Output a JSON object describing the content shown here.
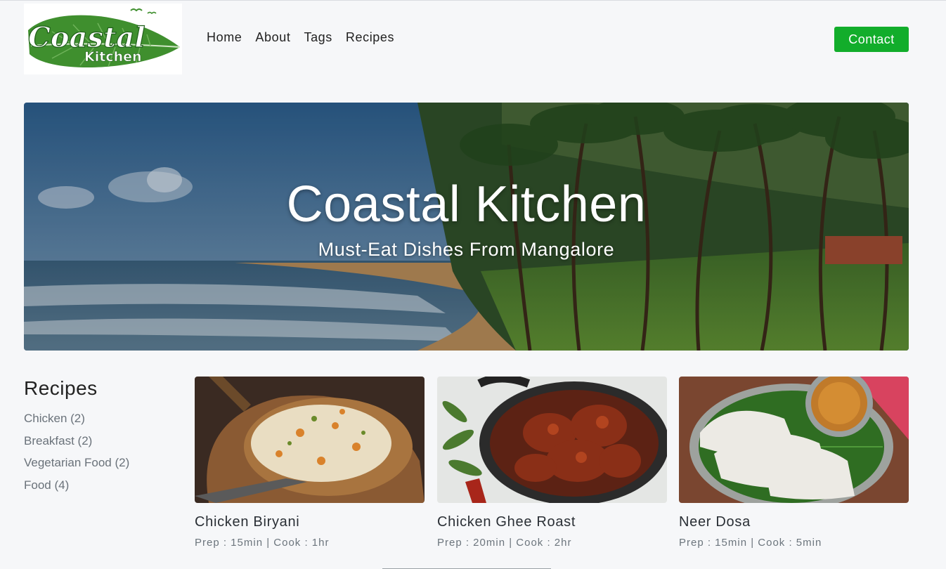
{
  "brand": {
    "logo_line1": "Coastal",
    "logo_line2": "Kitchen"
  },
  "nav": {
    "links": [
      {
        "label": "Home"
      },
      {
        "label": "About"
      },
      {
        "label": "Tags"
      },
      {
        "label": "Recipes"
      }
    ],
    "contact_label": "Contact"
  },
  "hero": {
    "title": "Coastal Kitchen",
    "subtitle": "Must-Eat Dishes From Mangalore"
  },
  "sidebar": {
    "title": "Recipes",
    "tags": [
      {
        "label": "Chicken (2)"
      },
      {
        "label": "Breakfast (2)"
      },
      {
        "label": "Vegetarian Food (2)"
      },
      {
        "label": "Food (4)"
      }
    ]
  },
  "recipes": [
    {
      "title": "Chicken Biryani",
      "meta": "Prep : 15min | Cook : 1hr"
    },
    {
      "title": "Chicken Ghee Roast",
      "meta": "Prep : 20min | Cook : 2hr"
    },
    {
      "title": "Neer Dosa",
      "meta": "Prep : 15min | Cook : 5min"
    }
  ],
  "colors": {
    "accent": "#12ad2b",
    "background": "#f6f7f9",
    "muted_text": "#6c757d"
  }
}
